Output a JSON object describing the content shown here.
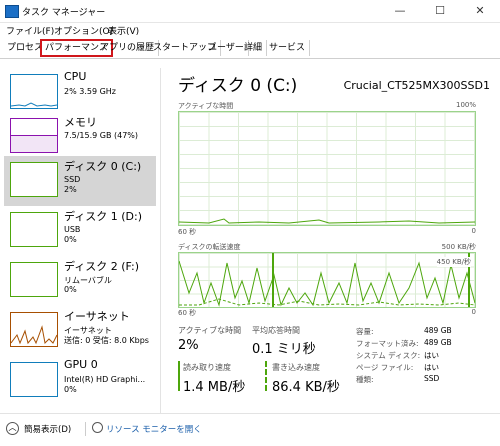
{
  "window": {
    "title": "タスク マネージャー"
  },
  "menu": [
    "ファイル(F)",
    "オプション(O)",
    "表示(V)"
  ],
  "tabs": [
    "プロセス",
    "パフォーマンス",
    "アプリの履歴",
    "スタートアップ",
    "ユーザー",
    "詳細",
    "サービス"
  ],
  "sidebar": [
    {
      "name": "CPU",
      "line1": "2%  3.59 GHz",
      "line2": ""
    },
    {
      "name": "メモリ",
      "line1": "7.5/15.9 GB (47%)",
      "line2": ""
    },
    {
      "name": "ディスク 0 (C:)",
      "line1": "SSD",
      "line2": "2%"
    },
    {
      "name": "ディスク 1 (D:)",
      "line1": "USB",
      "line2": "0%"
    },
    {
      "name": "ディスク 2 (F:)",
      "line1": "リムーバブル",
      "line2": "0%"
    },
    {
      "name": "イーサネット",
      "line1": "イーサネット",
      "line2": "送信: 0  受信: 8.0 Kbps"
    },
    {
      "name": "GPU 0",
      "line1": "Intel(R) HD Graphi...",
      "line2": "0%"
    }
  ],
  "main": {
    "title": "ディスク 0 (C:)",
    "model": "Crucial_CT525MX300SSD1",
    "graph1": {
      "label": "アクティブな時間",
      "max": "100%",
      "time": "60 秒",
      "min": "0"
    },
    "graph2": {
      "label": "ディスクの転送速度",
      "max": "500 KB/秒",
      "mid": "450 KB/秒",
      "time": "60 秒",
      "min": "0"
    },
    "stats": {
      "active_label": "アクティブな時間",
      "active_value": "2%",
      "resp_label": "平均応答時間",
      "resp_value": "0.1 ミリ秒",
      "read_label": "読み取り速度",
      "read_value": "1.4 MB/秒",
      "write_label": "書き込み速度",
      "write_value": "86.4 KB/秒"
    },
    "props": [
      {
        "k": "容量:",
        "v": "489 GB"
      },
      {
        "k": "フォーマット済み:",
        "v": "489 GB"
      },
      {
        "k": "システム ディスク:",
        "v": "はい"
      },
      {
        "k": "ページ ファイル:",
        "v": "はい"
      },
      {
        "k": "種類:",
        "v": "SSD"
      }
    ]
  },
  "footer": {
    "fewer": "簡易表示(D)",
    "resmon": "リソース モニターを開く"
  },
  "colors": {
    "accent": "#4da52c",
    "cpu": "#117dbb",
    "mem": "#8b12ae",
    "disk": "#4da60c",
    "net": "#a74f01",
    "selected": "#d5d5d5",
    "tab_highlight": "#d0161b"
  }
}
